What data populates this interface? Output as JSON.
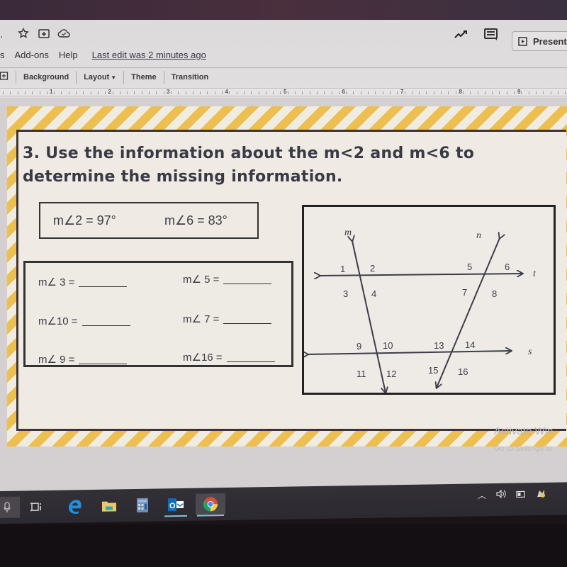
{
  "browser": {
    "url_text": ""
  },
  "app": {
    "title_icons": [
      "star-icon",
      "move-to-folder-icon",
      "cloud-saved-icon"
    ],
    "menu": {
      "items": [
        "s",
        "Add-ons",
        "Help"
      ],
      "last_edit": "Last edit was 2 minutes ago"
    },
    "header_right": {
      "activity_icon": "trending-icon",
      "comments_icon": "comment-icon",
      "present_label": "Present"
    },
    "toolbar": {
      "items": [
        "Background",
        "Layout",
        "Theme",
        "Transition"
      ],
      "layout_has_dropdown": true
    },
    "ruler": {
      "labels": [
        "1",
        "2",
        "3",
        "4",
        "5",
        "6",
        "7",
        "8",
        "9"
      ]
    }
  },
  "slide": {
    "question": "3. Use the information about the m<2 and m<6 to determine the missing information.",
    "given": [
      {
        "label": "m∠2 = 97°"
      },
      {
        "label": "m∠6 = 83°"
      }
    ],
    "answers": [
      {
        "label": "m∠ 3  ="
      },
      {
        "label": "m∠ 5  ="
      },
      {
        "label": "m∠10 ="
      },
      {
        "label": "m∠ 7  ="
      },
      {
        "label": "m∠ 9  ="
      },
      {
        "label": "m∠16 ="
      }
    ],
    "diagram": {
      "lines": {
        "transversal_left": "m",
        "transversal_right": "n",
        "top_line": "t",
        "bottom_line": "s"
      },
      "angle_labels": [
        "1",
        "2",
        "3",
        "4",
        "5",
        "6",
        "7",
        "8",
        "9",
        "10",
        "11",
        "12",
        "13",
        "14",
        "15",
        "16"
      ]
    }
  },
  "watermark": {
    "line1": "Activate Win",
    "line2": "Go to Settings to"
  },
  "taskbar": {
    "apps": [
      "cortana-mic",
      "task-view",
      "edge",
      "file-explorer",
      "calculator",
      "outlook",
      "chrome"
    ],
    "tray": [
      "show-hidden-icons",
      "volume",
      "battery",
      "network"
    ]
  }
}
